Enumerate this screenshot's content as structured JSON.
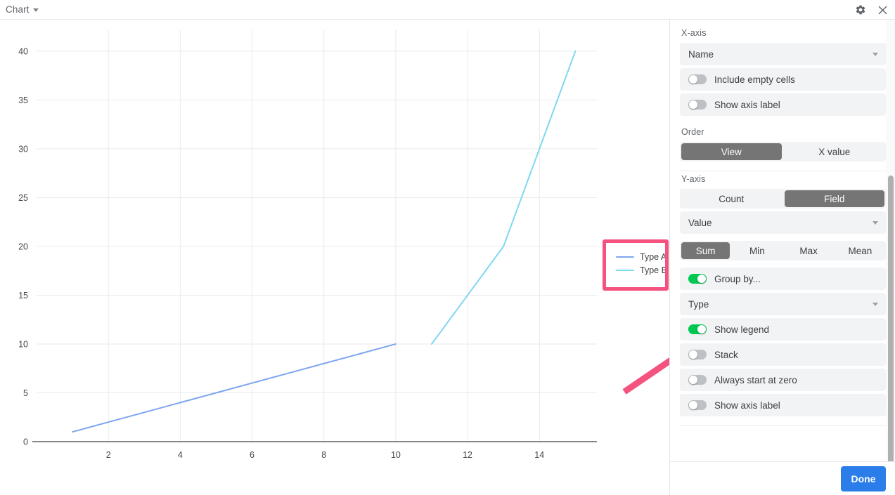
{
  "topbar": {
    "title": "Chart",
    "caret_icon": "chevron-down-icon",
    "settings_icon": "gear-icon",
    "close_icon": "close-icon"
  },
  "chart_data": {
    "type": "line",
    "title": "",
    "xlabel": "",
    "ylabel": "",
    "xlim": [
      0,
      15.6
    ],
    "ylim": [
      0,
      41.5
    ],
    "xticks": [
      2,
      4,
      6,
      8,
      10,
      12,
      14
    ],
    "yticks": [
      0,
      5,
      10,
      15,
      20,
      25,
      30,
      35,
      40
    ],
    "grid": true,
    "legend_position": "right",
    "series": [
      {
        "name": "Type A",
        "color": "#7da6f0",
        "points": [
          [
            1,
            1
          ],
          [
            2,
            2
          ],
          [
            3,
            3
          ],
          [
            4,
            4
          ],
          [
            5,
            5
          ],
          [
            6,
            6
          ],
          [
            7,
            7
          ],
          [
            8,
            8
          ],
          [
            9,
            9
          ],
          [
            10,
            10
          ]
        ]
      },
      {
        "name": "Type B",
        "color": "#7fd7f2",
        "points": [
          [
            11,
            10
          ],
          [
            12,
            15
          ],
          [
            13,
            20
          ],
          [
            14,
            30
          ],
          [
            15,
            40
          ]
        ]
      }
    ]
  },
  "legend": {
    "items": [
      {
        "label": "Type A",
        "color": "#7da6f0"
      },
      {
        "label": "Type B",
        "color": "#7fd7f2"
      }
    ]
  },
  "annotations": {
    "box_color": "#f4527f",
    "arrow_color": "#f4527f"
  },
  "panel": {
    "xaxis": {
      "label": "X-axis",
      "field": {
        "value": "Name",
        "caret_icon": "chevron-down-icon"
      },
      "toggles": [
        {
          "label": "Include empty cells",
          "on": false
        },
        {
          "label": "Show axis label",
          "on": false
        }
      ],
      "order": {
        "label": "Order",
        "options": [
          "View",
          "X value"
        ],
        "selected": "View"
      }
    },
    "yaxis": {
      "label": "Y-axis",
      "mode": {
        "options": [
          "Count",
          "Field"
        ],
        "selected": "Field"
      },
      "field": {
        "value": "Value",
        "caret_icon": "chevron-down-icon"
      },
      "aggregate": {
        "options": [
          "Sum",
          "Min",
          "Max",
          "Mean"
        ],
        "selected": "Sum"
      },
      "group_by": {
        "label": "Group by...",
        "on": true
      },
      "group_field": {
        "value": "Type",
        "caret_icon": "chevron-down-icon"
      },
      "toggles": [
        {
          "label": "Show legend",
          "on": true
        },
        {
          "label": "Stack",
          "on": false
        },
        {
          "label": "Always start at zero",
          "on": false
        },
        {
          "label": "Show axis label",
          "on": false
        }
      ]
    },
    "footer": {
      "done_label": "Done",
      "done_color": "#2b7de9"
    }
  }
}
